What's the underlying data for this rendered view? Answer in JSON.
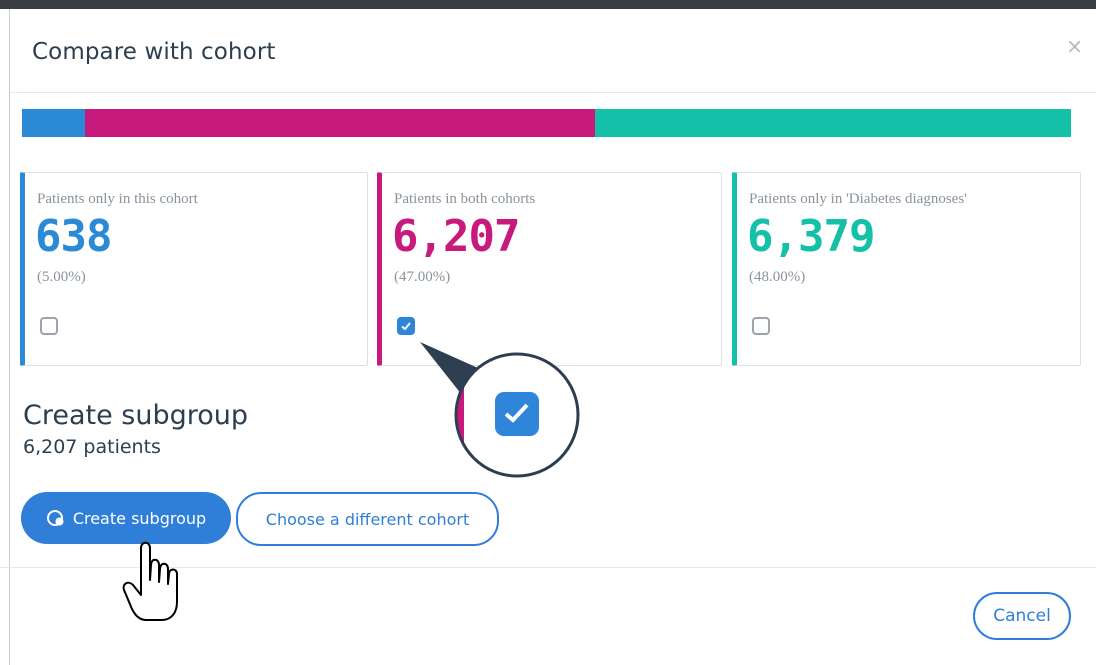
{
  "modal": {
    "title": "Compare with cohort",
    "close_label": "×"
  },
  "bar": {
    "segments": [
      {
        "name": "only-this",
        "fraction": 0.06,
        "color": "#2b8ad6"
      },
      {
        "name": "both",
        "fraction": 0.486,
        "color": "#c81a7c"
      },
      {
        "name": "only-other",
        "fraction": 0.454,
        "color": "#14c0a8"
      }
    ]
  },
  "cards": [
    {
      "label": "Patients only in this cohort",
      "value": "638",
      "percent": "(5.00%)",
      "color": "#2b8ad6",
      "checked": false
    },
    {
      "label": "Patients in both cohorts",
      "value": "6,207",
      "percent": "(47.00%)",
      "color": "#c81a7c",
      "checked": true
    },
    {
      "label": "Patients only in 'Diabetes diagnoses'",
      "value": "6,379",
      "percent": "(48.00%)",
      "color": "#14c0a8",
      "checked": false
    }
  ],
  "subgroup": {
    "title": "Create subgroup",
    "count": "6,207 patients"
  },
  "buttons": {
    "create": "Create subgroup",
    "choose": "Choose a different cohort",
    "cancel": "Cancel"
  }
}
